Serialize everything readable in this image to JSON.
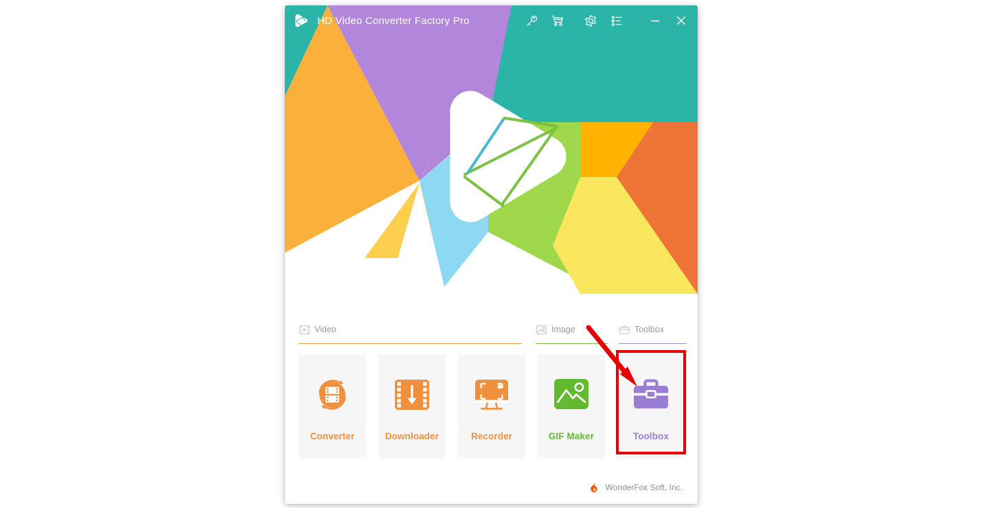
{
  "window": {
    "title": "HD Video Converter Factory Pro",
    "logo_icon": "app-play-logo-icon"
  },
  "titlebar": {
    "buttons": [
      {
        "name": "register-key-button",
        "icon": "key-icon",
        "tooltip_label": "Register"
      },
      {
        "name": "purchase-cart-button",
        "icon": "cart-icon",
        "tooltip_label": "Buy Now"
      },
      {
        "name": "settings-gear-button",
        "icon": "gear-icon",
        "tooltip_label": "Settings"
      },
      {
        "name": "menu-list-button",
        "icon": "list-menu-icon",
        "tooltip_label": "Menu"
      },
      {
        "name": "minimize-button",
        "icon": "minimize-icon",
        "tooltip_label": "Minimize"
      },
      {
        "name": "close-button",
        "icon": "close-icon",
        "tooltip_label": "Close"
      }
    ]
  },
  "sections": [
    {
      "label": "Video",
      "icon": "film-strip-icon",
      "rule_color": "#ef9a4a"
    },
    {
      "label": "Image",
      "icon": "picture-icon",
      "rule_color": "#7bbf3f"
    },
    {
      "label": "Toolbox",
      "icon": "briefcase-icon",
      "rule_color": "#9a93c9"
    }
  ],
  "tiles": [
    {
      "label": "Converter",
      "icon": "converter-icon",
      "color": "#f0903c",
      "section": "Video"
    },
    {
      "label": "Downloader",
      "icon": "downloader-icon",
      "color": "#f0903c",
      "section": "Video"
    },
    {
      "label": "Recorder",
      "icon": "recorder-icon",
      "color": "#f0903c",
      "section": "Video"
    },
    {
      "label": "GIF Maker",
      "icon": "gif-maker-icon",
      "color": "#62bb2e",
      "section": "Image"
    },
    {
      "label": "Toolbox",
      "icon": "toolbox-icon",
      "color": "#9b7ed4",
      "section": "Toolbox"
    }
  ],
  "footer": {
    "company": "WonderFox Soft, Inc.",
    "logo_icon": "wonderfox-flame-icon"
  },
  "annotation": {
    "arrow_color": "#e60000",
    "highlight_color": "#e60000",
    "highlight_target": "Toolbox"
  },
  "banner": {
    "colors": {
      "teal": "#2ab5a8",
      "purple": "#b286db",
      "orange_gold": "#fbb03b",
      "amber": "#ffb300",
      "orange_red": "#ee7536",
      "green": "#9fd84a",
      "light_yellow": "#fbe75e",
      "sky_blue": "#8dd9f4",
      "yellow": "#fcd04e"
    }
  }
}
